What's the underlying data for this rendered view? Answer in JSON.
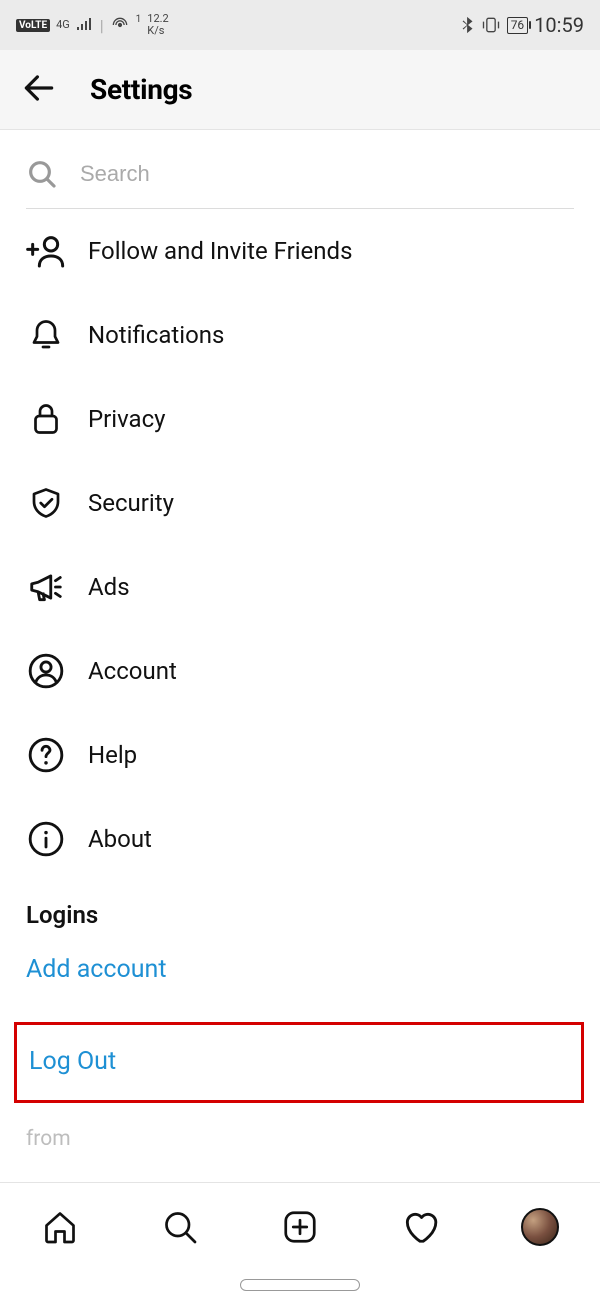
{
  "status": {
    "volte": "VoLTE",
    "signal_type": "4G",
    "hotspot_sup": "1",
    "speed_top": "12.2",
    "speed_bottom": "K/s",
    "battery": "76",
    "time": "10:59"
  },
  "header": {
    "title": "Settings"
  },
  "search": {
    "placeholder": "Search"
  },
  "menu": [
    {
      "label": "Follow and Invite Friends"
    },
    {
      "label": "Notifications"
    },
    {
      "label": "Privacy"
    },
    {
      "label": "Security"
    },
    {
      "label": "Ads"
    },
    {
      "label": "Account"
    },
    {
      "label": "Help"
    },
    {
      "label": "About"
    }
  ],
  "logins": {
    "title": "Logins",
    "add_account": "Add account",
    "log_out": "Log Out"
  },
  "footer": {
    "from": "from"
  }
}
